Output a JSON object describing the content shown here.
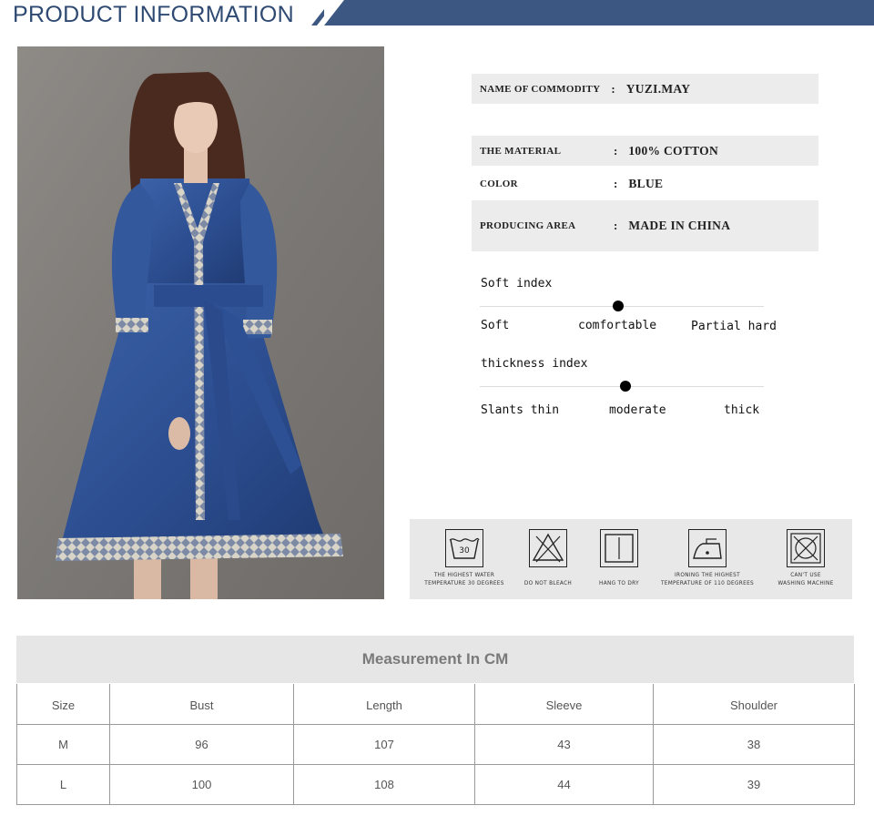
{
  "header": {
    "title": "PRODUCT INFORMATION"
  },
  "colors": {
    "brand_navy": "#3b5782",
    "shade_gray": "#ececec",
    "denim_blue": "#2f5190"
  },
  "specs": [
    {
      "label": "NAME OF COMMODITY",
      "colon": ":",
      "value": "YUZI.MAY"
    },
    {
      "label": "THE MATERIAL",
      "colon": ":",
      "value": "100% COTTON"
    },
    {
      "label": "COLOR",
      "colon": ":",
      "value": "BLUE"
    },
    {
      "label": "PRODUCING AREA",
      "colon": ":",
      "value": "MADE IN CHINA"
    }
  ],
  "soft_index": {
    "title": "Soft index",
    "left": "Soft",
    "middle": "comfortable",
    "right": "Partial hard",
    "level": 0.5
  },
  "thickness_index": {
    "title": "thickness index",
    "left": "Slants thin",
    "middle": "moderate",
    "right": "thick",
    "level": 0.5
  },
  "care": [
    {
      "icon": "wash-30-icon",
      "symbol": "30",
      "label_1": "THE HIGHEST WATER",
      "label_2": "TEMPERATURE 30 DEGREES"
    },
    {
      "icon": "do-not-bleach-icon",
      "label_1": "",
      "label_2": "DO NOT BLEACH"
    },
    {
      "icon": "hang-dry-icon",
      "label_1": "",
      "label_2": "HANG TO DRY"
    },
    {
      "icon": "iron-icon",
      "label_1": "IRONING THE HIGHEST",
      "label_2": "TEMPERATURE OF 110 DEGREES"
    },
    {
      "icon": "no-machine-wash-icon",
      "label_1": "CAN'T USE",
      "label_2": "WASHING MACHINE"
    }
  ],
  "measurement": {
    "title": "Measurement In CM",
    "columns": [
      "Size",
      "Bust",
      "Length",
      "Sleeve",
      "Shoulder"
    ],
    "rows": [
      [
        "M",
        "96",
        "107",
        "43",
        "38"
      ],
      [
        "L",
        "100",
        "108",
        "44",
        "39"
      ]
    ]
  }
}
